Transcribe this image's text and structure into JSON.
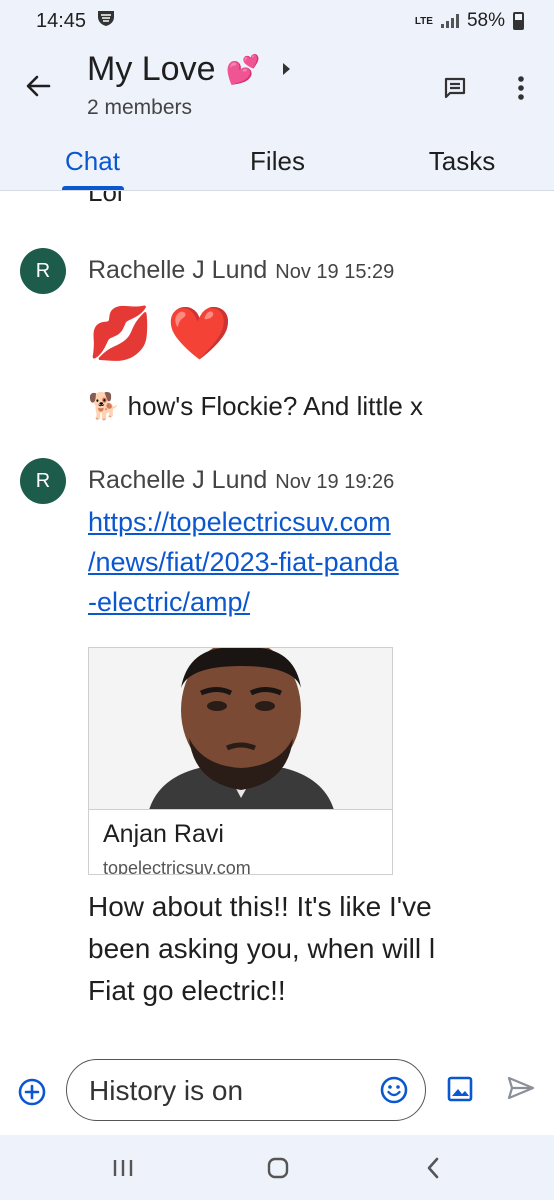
{
  "status_bar": {
    "time": "14:45",
    "network": "LTE",
    "battery": "58%",
    "icons": [
      "shield-icon",
      "signal-icon",
      "battery-icon"
    ]
  },
  "header": {
    "title": "My Love",
    "title_emoji": "💕",
    "subtitle": "2 members",
    "icons": [
      "back-arrow-icon",
      "chevron-right-icon",
      "threads-icon",
      "more-vert-icon"
    ]
  },
  "tabs": [
    {
      "label": "Chat",
      "active": true
    },
    {
      "label": "Files",
      "active": false
    },
    {
      "label": "Tasks",
      "active": false
    }
  ],
  "chat": {
    "cut_message": "Lol",
    "messages": [
      {
        "avatar_initial": "R",
        "sender": "Rachelle J Lund",
        "time": "Nov 19 15:29",
        "emojis": "💋 ❤️",
        "text_emoji": "🐕",
        "text": "how's Flockie? And little x"
      },
      {
        "avatar_initial": "R",
        "sender": "Rachelle J Lund",
        "time": "Nov 19 19:26",
        "link_lines": [
          "https://topelectricsuv.com",
          "/news/fiat/2023-fiat-panda",
          "-electric/amp/"
        ],
        "card": {
          "title": "Anjan Ravi",
          "domain": "topelectricsuv.com"
        },
        "text_lines": [
          "How about this!! It's like I've",
          "been asking you, when will l",
          "Fiat go electric!!"
        ]
      }
    ]
  },
  "composer": {
    "placeholder": "History is on",
    "icons": [
      "add-circle-icon",
      "emoji-icon",
      "image-icon",
      "send-icon"
    ]
  },
  "navbar": {
    "icons": [
      "recents-icon",
      "home-icon",
      "back-icon"
    ]
  },
  "colors": {
    "accent": "#0b57d0",
    "header_bg": "#eef3fb",
    "avatar_bg": "#1d5b4a"
  }
}
